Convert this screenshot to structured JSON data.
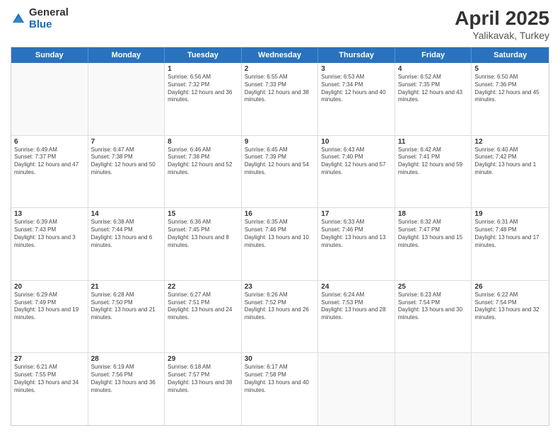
{
  "header": {
    "logo_general": "General",
    "logo_blue": "Blue",
    "title": "April 2025",
    "location": "Yalikavak, Turkey"
  },
  "days_of_week": [
    "Sunday",
    "Monday",
    "Tuesday",
    "Wednesday",
    "Thursday",
    "Friday",
    "Saturday"
  ],
  "weeks": [
    [
      {
        "day": "",
        "info": ""
      },
      {
        "day": "",
        "info": ""
      },
      {
        "day": "1",
        "info": "Sunrise: 6:56 AM\nSunset: 7:32 PM\nDaylight: 12 hours and 36 minutes."
      },
      {
        "day": "2",
        "info": "Sunrise: 6:55 AM\nSunset: 7:33 PM\nDaylight: 12 hours and 38 minutes."
      },
      {
        "day": "3",
        "info": "Sunrise: 6:53 AM\nSunset: 7:34 PM\nDaylight: 12 hours and 40 minutes."
      },
      {
        "day": "4",
        "info": "Sunrise: 6:52 AM\nSunset: 7:35 PM\nDaylight: 12 hours and 43 minutes."
      },
      {
        "day": "5",
        "info": "Sunrise: 6:50 AM\nSunset: 7:36 PM\nDaylight: 12 hours and 45 minutes."
      }
    ],
    [
      {
        "day": "6",
        "info": "Sunrise: 6:49 AM\nSunset: 7:37 PM\nDaylight: 12 hours and 47 minutes."
      },
      {
        "day": "7",
        "info": "Sunrise: 6:47 AM\nSunset: 7:38 PM\nDaylight: 12 hours and 50 minutes."
      },
      {
        "day": "8",
        "info": "Sunrise: 6:46 AM\nSunset: 7:38 PM\nDaylight: 12 hours and 52 minutes."
      },
      {
        "day": "9",
        "info": "Sunrise: 6:45 AM\nSunset: 7:39 PM\nDaylight: 12 hours and 54 minutes."
      },
      {
        "day": "10",
        "info": "Sunrise: 6:43 AM\nSunset: 7:40 PM\nDaylight: 12 hours and 57 minutes."
      },
      {
        "day": "11",
        "info": "Sunrise: 6:42 AM\nSunset: 7:41 PM\nDaylight: 12 hours and 59 minutes."
      },
      {
        "day": "12",
        "info": "Sunrise: 6:40 AM\nSunset: 7:42 PM\nDaylight: 13 hours and 1 minute."
      }
    ],
    [
      {
        "day": "13",
        "info": "Sunrise: 6:39 AM\nSunset: 7:43 PM\nDaylight: 13 hours and 3 minutes."
      },
      {
        "day": "14",
        "info": "Sunrise: 6:38 AM\nSunset: 7:44 PM\nDaylight: 13 hours and 6 minutes."
      },
      {
        "day": "15",
        "info": "Sunrise: 6:36 AM\nSunset: 7:45 PM\nDaylight: 13 hours and 8 minutes."
      },
      {
        "day": "16",
        "info": "Sunrise: 6:35 AM\nSunset: 7:46 PM\nDaylight: 13 hours and 10 minutes."
      },
      {
        "day": "17",
        "info": "Sunrise: 6:33 AM\nSunset: 7:46 PM\nDaylight: 13 hours and 13 minutes."
      },
      {
        "day": "18",
        "info": "Sunrise: 6:32 AM\nSunset: 7:47 PM\nDaylight: 13 hours and 15 minutes."
      },
      {
        "day": "19",
        "info": "Sunrise: 6:31 AM\nSunset: 7:48 PM\nDaylight: 13 hours and 17 minutes."
      }
    ],
    [
      {
        "day": "20",
        "info": "Sunrise: 6:29 AM\nSunset: 7:49 PM\nDaylight: 13 hours and 19 minutes."
      },
      {
        "day": "21",
        "info": "Sunrise: 6:28 AM\nSunset: 7:50 PM\nDaylight: 13 hours and 21 minutes."
      },
      {
        "day": "22",
        "info": "Sunrise: 6:27 AM\nSunset: 7:51 PM\nDaylight: 13 hours and 24 minutes."
      },
      {
        "day": "23",
        "info": "Sunrise: 6:26 AM\nSunset: 7:52 PM\nDaylight: 13 hours and 26 minutes."
      },
      {
        "day": "24",
        "info": "Sunrise: 6:24 AM\nSunset: 7:53 PM\nDaylight: 13 hours and 28 minutes."
      },
      {
        "day": "25",
        "info": "Sunrise: 6:23 AM\nSunset: 7:54 PM\nDaylight: 13 hours and 30 minutes."
      },
      {
        "day": "26",
        "info": "Sunrise: 6:22 AM\nSunset: 7:54 PM\nDaylight: 13 hours and 32 minutes."
      }
    ],
    [
      {
        "day": "27",
        "info": "Sunrise: 6:21 AM\nSunset: 7:55 PM\nDaylight: 13 hours and 34 minutes."
      },
      {
        "day": "28",
        "info": "Sunrise: 6:19 AM\nSunset: 7:56 PM\nDaylight: 13 hours and 36 minutes."
      },
      {
        "day": "29",
        "info": "Sunrise: 6:18 AM\nSunset: 7:57 PM\nDaylight: 13 hours and 38 minutes."
      },
      {
        "day": "30",
        "info": "Sunrise: 6:17 AM\nSunset: 7:58 PM\nDaylight: 13 hours and 40 minutes."
      },
      {
        "day": "",
        "info": ""
      },
      {
        "day": "",
        "info": ""
      },
      {
        "day": "",
        "info": ""
      }
    ]
  ]
}
